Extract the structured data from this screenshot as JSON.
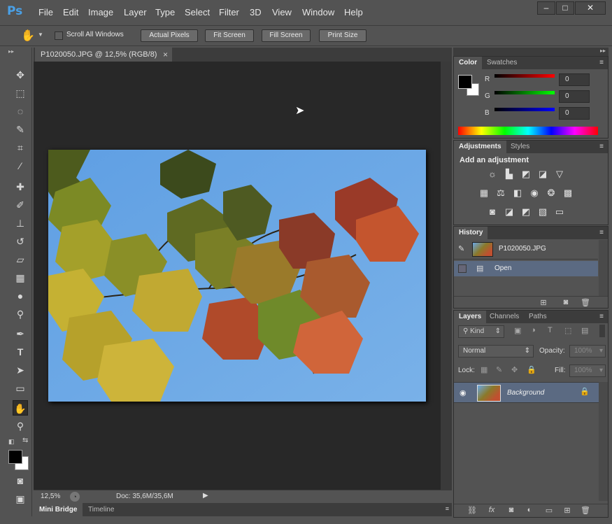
{
  "app": {
    "logo": "Ps",
    "menu": [
      "File",
      "Edit",
      "Image",
      "Layer",
      "Type",
      "Select",
      "Filter",
      "3D",
      "View",
      "Window",
      "Help"
    ],
    "window_controls": {
      "minimize": "–",
      "maximize": "□",
      "close": "✕"
    }
  },
  "options_bar": {
    "scroll_all_windows": "Scroll All Windows",
    "actual_pixels": "Actual Pixels",
    "fit_screen": "Fit Screen",
    "fill_screen": "Fill Screen",
    "print_size": "Print Size"
  },
  "document": {
    "tab_title": "P1020050.JPG @ 12,5% (RGB/8)",
    "tab_close": "×",
    "zoom": "12,5%",
    "doc_size": "Doc: 35,6M/35,6M"
  },
  "bottom_tabs": {
    "mini_bridge": "Mini Bridge",
    "timeline": "Timeline"
  },
  "color_panel": {
    "tabs": {
      "color": "Color",
      "swatches": "Swatches"
    },
    "r_label": "R",
    "g_label": "G",
    "b_label": "B",
    "r_value": "0",
    "g_value": "0",
    "b_value": "0"
  },
  "adjustments_panel": {
    "tabs": {
      "adjustments": "Adjustments",
      "styles": "Styles"
    },
    "heading": "Add an adjustment"
  },
  "history_panel": {
    "tab": "History",
    "snapshot": "P1020050.JPG",
    "step": "Open"
  },
  "layers_panel": {
    "tabs": {
      "layers": "Layers",
      "channels": "Channels",
      "paths": "Paths"
    },
    "filter_kind": "Kind",
    "blend_mode": "Normal",
    "opacity_label": "Opacity:",
    "opacity_value": "100%",
    "lock_label": "Lock:",
    "fill_label": "Fill:",
    "fill_value": "100%",
    "layer_name": "Background"
  },
  "colors": {
    "accent": "#4aa0e6",
    "sky": "#6aa8e6",
    "selected_row": "#5b6a82"
  }
}
